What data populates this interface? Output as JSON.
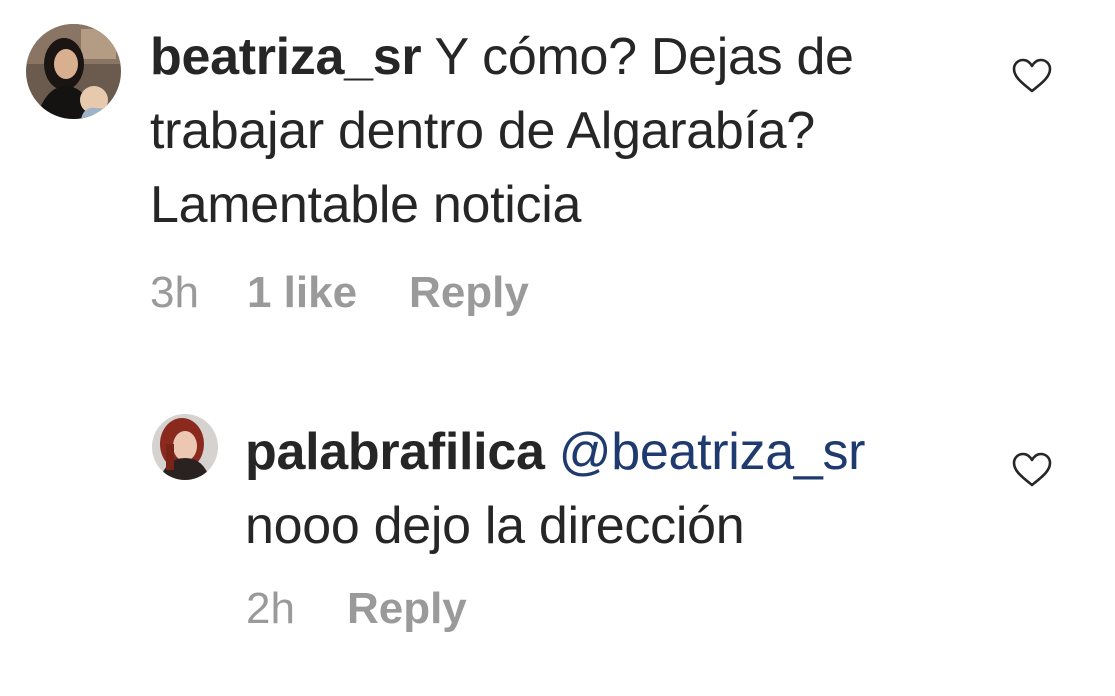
{
  "comments": [
    {
      "username": "beatriza_sr",
      "text": "Y cómo? Dejas de trabajar dentro de Algarabía? Lamentable noticia",
      "time": "3h",
      "likes": "1 like",
      "reply": "Reply",
      "avatar_icon": "user-avatar-photo",
      "like_icon": "heart-outline-icon"
    },
    {
      "username": "palabrafilica",
      "mention": "@beatriza_sr",
      "text": "nooo dejo la dirección",
      "time": "2h",
      "reply": "Reply",
      "avatar_icon": "user-avatar-photo",
      "like_icon": "heart-outline-icon"
    }
  ],
  "colors": {
    "text": "#262626",
    "meta": "#9a9a9a",
    "mention": "#1e3a6e",
    "background": "#ffffff"
  }
}
